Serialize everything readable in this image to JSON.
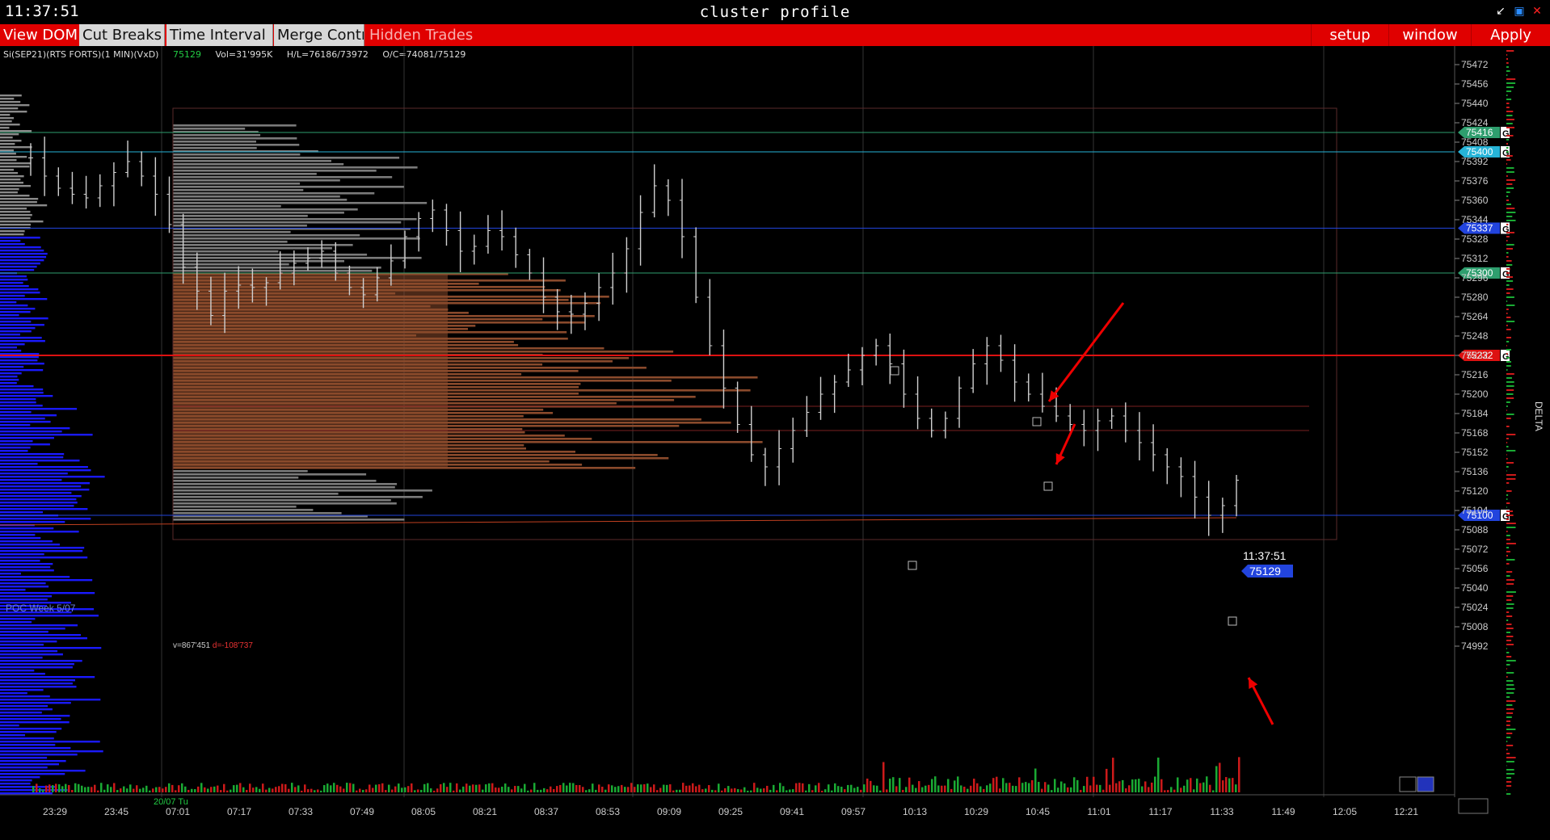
{
  "clock": "11:37:51",
  "window_title": "cluster profile",
  "window_controls": [
    "minimize-icon",
    "maximize-icon",
    "close-icon"
  ],
  "toolbar": {
    "view_dom": "View DOM",
    "cut_breaks": "Cut Breaks",
    "time_interval": "Time Interval",
    "merge_contr": "Merge Contr",
    "hidden_trades": "Hidden Trades",
    "setup": "setup",
    "window": "window",
    "apply": "Apply"
  },
  "info": {
    "symbol": "Si(SEP21)(RTS FORTS)(1 MIN)(VxD)",
    "last": "75129",
    "vol": "Vol=31'995K",
    "hl": "H/L=76186/73972",
    "oc": "O/C=74081/75129"
  },
  "profile_stats": {
    "v": "v=867'451",
    "d": "d=-108'737"
  },
  "poc_label": "POC Week 5/07",
  "side_label": "DELTA",
  "current": {
    "time": "11:37:51",
    "price": "75129"
  },
  "date_label": "20/07 Tu",
  "colors": {
    "toolbar": "#e00000",
    "candle": "#d0d0d0",
    "profile_value_area": "#8a4a2c",
    "profile_rest": "#7a7a7a",
    "left_profile": "#1a1aff",
    "level_green": "#2e9e6e",
    "level_cyan": "#26b4d8",
    "level_blue": "#2244dd",
    "level_red": "#dd1111"
  },
  "chart_data": {
    "type": "candlestick",
    "x_tick_labels": [
      "23:29",
      "23:45",
      "07:01",
      "07:17",
      "07:33",
      "07:49",
      "08:05",
      "08:21",
      "08:37",
      "08:53",
      "09:09",
      "09:25",
      "09:41",
      "09:57",
      "10:13",
      "10:29",
      "10:45",
      "11:01",
      "11:17",
      "11:33",
      "11:49",
      "12:05",
      "12:21"
    ],
    "y_tick_labels": [
      75472,
      75456,
      75440,
      75424,
      75408,
      75392,
      75376,
      75360,
      75344,
      75328,
      75312,
      75296,
      75280,
      75264,
      75248,
      75232,
      75216,
      75200,
      75184,
      75168,
      75152,
      75136,
      75120,
      75104,
      75088,
      75072,
      75056,
      75040,
      75024,
      75008,
      74992
    ],
    "y_range": [
      74984,
      75480
    ],
    "levels": [
      {
        "price": "75416",
        "color": "green"
      },
      {
        "price": "75400",
        "color": "cyan"
      },
      {
        "price": "75337",
        "color": "blue"
      },
      {
        "price": "75300",
        "color": "green"
      },
      {
        "price": "75232",
        "color": "red"
      },
      {
        "price": "75100",
        "color": "blue"
      }
    ],
    "level_badge": "G",
    "series_close": [
      75395,
      75380,
      75370,
      75365,
      75362,
      75372,
      75383,
      75392,
      75380,
      75365,
      75340,
      75305,
      75285,
      75265,
      75285,
      75290,
      75288,
      75292,
      75300,
      75308,
      75312,
      75318,
      75300,
      75288,
      75282,
      75296,
      75310,
      75330,
      75345,
      75352,
      75335,
      75318,
      75322,
      75335,
      75330,
      75315,
      75300,
      75280,
      75268,
      75266,
      75275,
      75288,
      75300,
      75320,
      75350,
      75372,
      75360,
      75330,
      75280,
      75240,
      75205,
      75175,
      75150,
      75140,
      75155,
      75170,
      75185,
      75200,
      75210,
      75220,
      75232,
      75240,
      75225,
      75200,
      75180,
      75170,
      75180,
      75205,
      75225,
      75240,
      75228,
      75210,
      75200,
      75190,
      75182,
      75175,
      75170,
      75178,
      75182,
      75170,
      75160,
      75150,
      75140,
      75132,
      75115,
      75100,
      75108,
      75129
    ]
  }
}
